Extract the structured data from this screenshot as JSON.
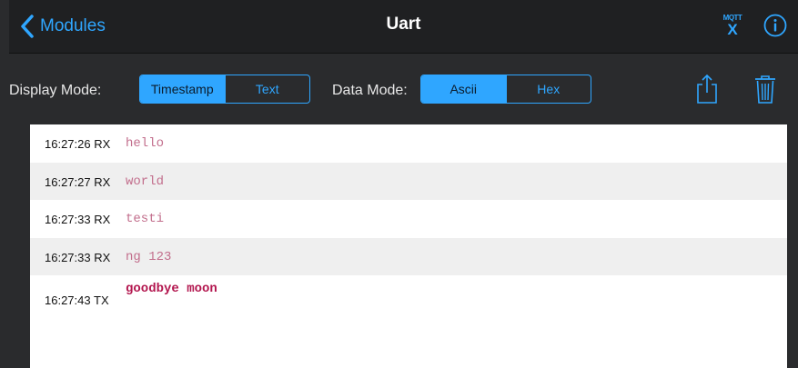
{
  "nav": {
    "back_label": "Modules",
    "title": "Uart",
    "mqtt_top": "MQTT",
    "mqtt_bottom": "X"
  },
  "toolbar": {
    "display_mode_label": "Display Mode:",
    "display_mode_options": [
      "Timestamp",
      "Text"
    ],
    "display_mode_selected": "Timestamp",
    "data_mode_label": "Data Mode:",
    "data_mode_options": [
      "Ascii",
      "Hex"
    ],
    "data_mode_selected": "Ascii"
  },
  "log": [
    {
      "time": "16:27:26",
      "dir": "RX",
      "text": "hello"
    },
    {
      "time": "16:27:27",
      "dir": "RX",
      "text": "world"
    },
    {
      "time": "16:27:33",
      "dir": "RX",
      "text": "testi"
    },
    {
      "time": "16:27:33",
      "dir": "RX",
      "text": "ng 123"
    },
    {
      "time": "16:27:43",
      "dir": "TX",
      "text": "goodbye moon"
    }
  ],
  "colors": {
    "accent": "#2fa6ff",
    "rx_text": "#c26e8c",
    "tx_text": "#b3174f",
    "nav_background": "#1f2022",
    "toolbar_background": "#2a2b2d"
  },
  "icons": {
    "back": "chevron-left-icon",
    "mqtt": "mqtt-icon",
    "info": "info-icon",
    "share": "share-icon",
    "trash": "trash-icon"
  }
}
